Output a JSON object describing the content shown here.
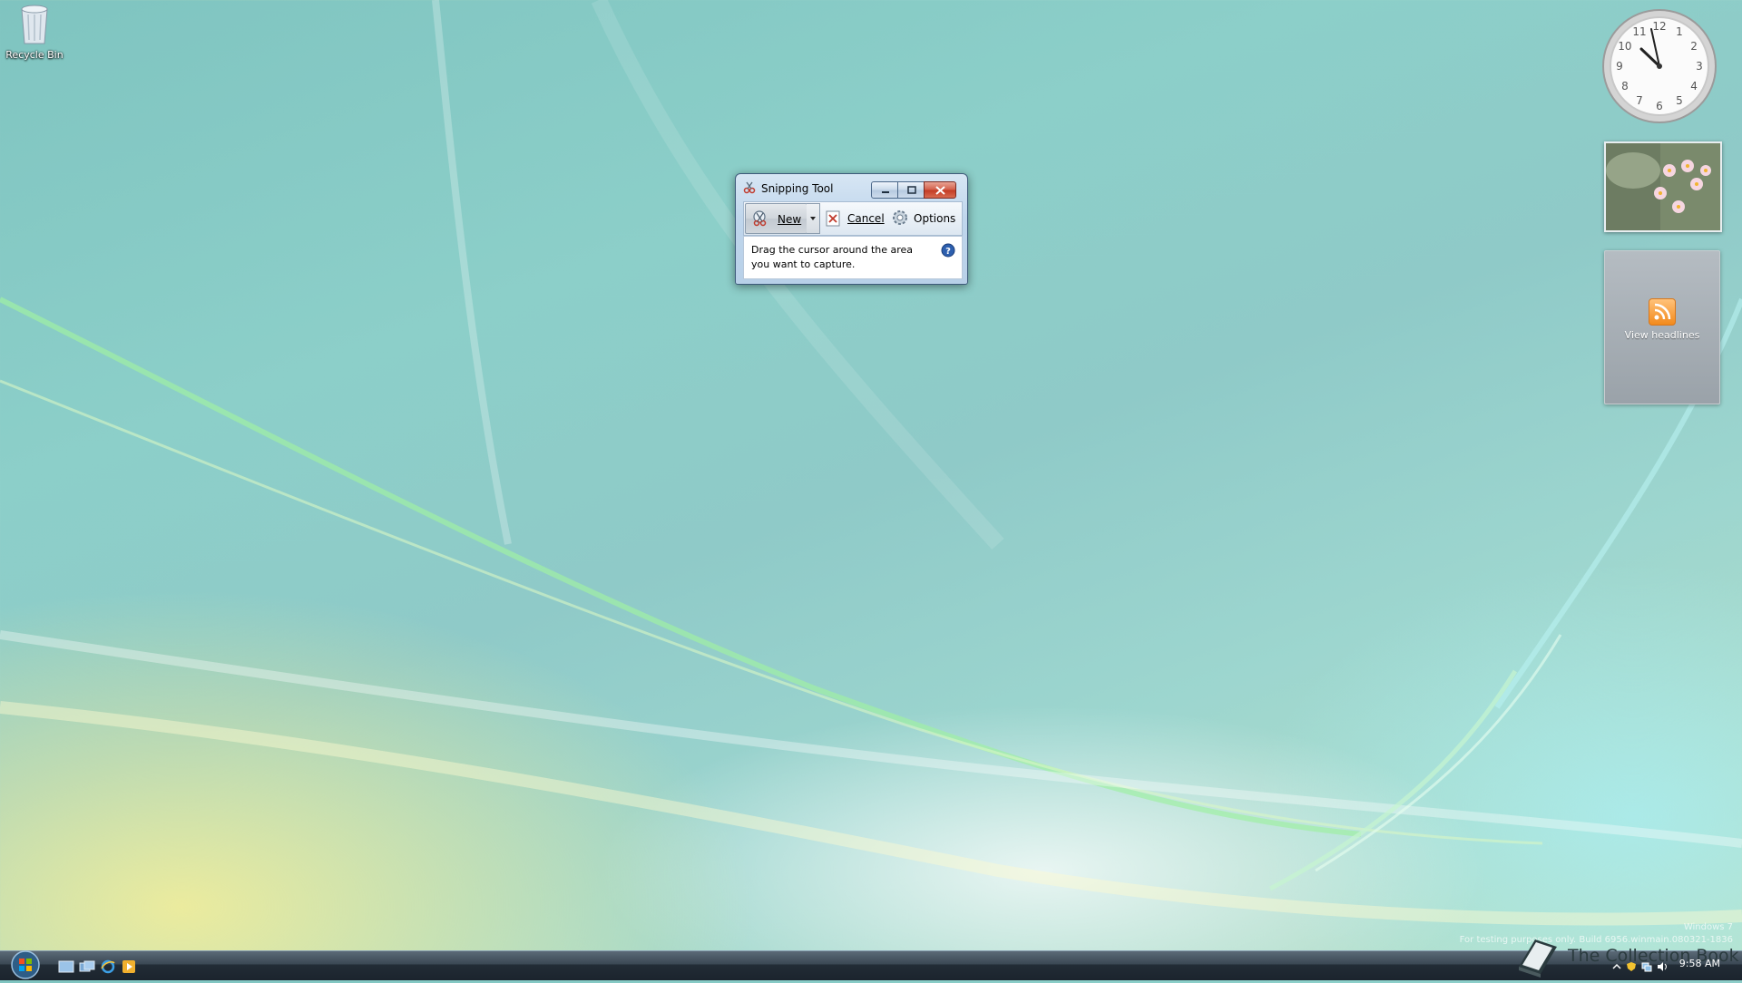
{
  "desktop": {
    "recycle_bin_label": "Recycle Bin"
  },
  "gadgets": {
    "feed_label": "View headlines",
    "clock_numerals": [
      "12",
      "1",
      "2",
      "3",
      "4",
      "5",
      "6",
      "7",
      "8",
      "9",
      "10",
      "11"
    ],
    "clock_time": "9:58"
  },
  "window": {
    "title": "Snipping Tool",
    "toolbar": {
      "new_label": "New",
      "cancel_label": "Cancel",
      "options_label": "Options"
    },
    "message_line1": "Drag the cursor around the area",
    "message_line2": "you want to capture."
  },
  "taskbar": {
    "time": "9:58 AM"
  },
  "watermark": {
    "text": "The Collection Book"
  },
  "build": {
    "line1": "Windows 7",
    "line2": "For testing purposes only. Build 6956.winmain.080321-1836"
  },
  "colors": {
    "titlebar_close": "#c23a23",
    "help_icon": "#2d5fae",
    "feed_icon": "#f28a1c"
  }
}
